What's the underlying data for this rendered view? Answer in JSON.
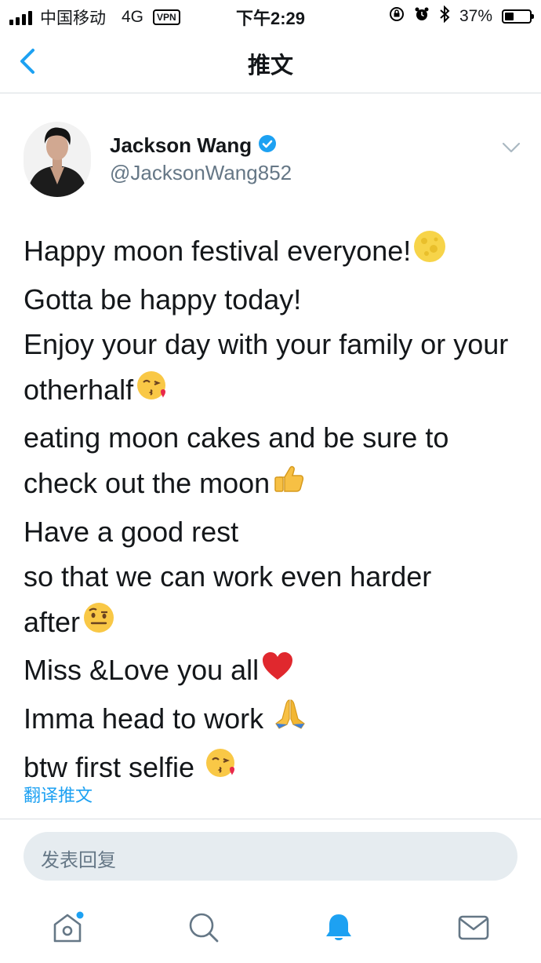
{
  "status_bar": {
    "carrier": "中国移动",
    "network": "4G",
    "vpn": "VPN",
    "time": "下午2:29",
    "battery_percent": "37%",
    "battery_level": 0.37
  },
  "nav": {
    "title": "推文"
  },
  "tweet": {
    "author_name": "Jackson Wang",
    "author_handle": "@JacksonWang852",
    "verified": true,
    "lines": [
      "Happy moon festival everyone!",
      "Gotta be happy today!",
      "Enjoy your day with your family or your",
      "otherhalf",
      "eating moon cakes and be sure to",
      "check out the moon",
      "Have a good rest",
      "so that we can work even harder",
      "after",
      "Miss &Love you all",
      "Imma head to work ",
      "btw first selfie "
    ],
    "emojis": [
      "moon-emoji",
      "kiss-emoji",
      "thumbs-up-emoji",
      "raised-eyebrow-emoji",
      "heart-emoji",
      "praying-hands-emoji",
      "kiss-emoji"
    ],
    "translate_label": "翻译推文"
  },
  "reply": {
    "placeholder": "发表回复"
  },
  "tabs": [
    "home-icon",
    "search-icon",
    "notifications-icon",
    "messages-icon"
  ],
  "colors": {
    "accent": "#1da1f2",
    "text": "#14171a",
    "secondary": "#657786",
    "reply_bg": "#e6ecf0",
    "divider": "#d9dee2"
  }
}
